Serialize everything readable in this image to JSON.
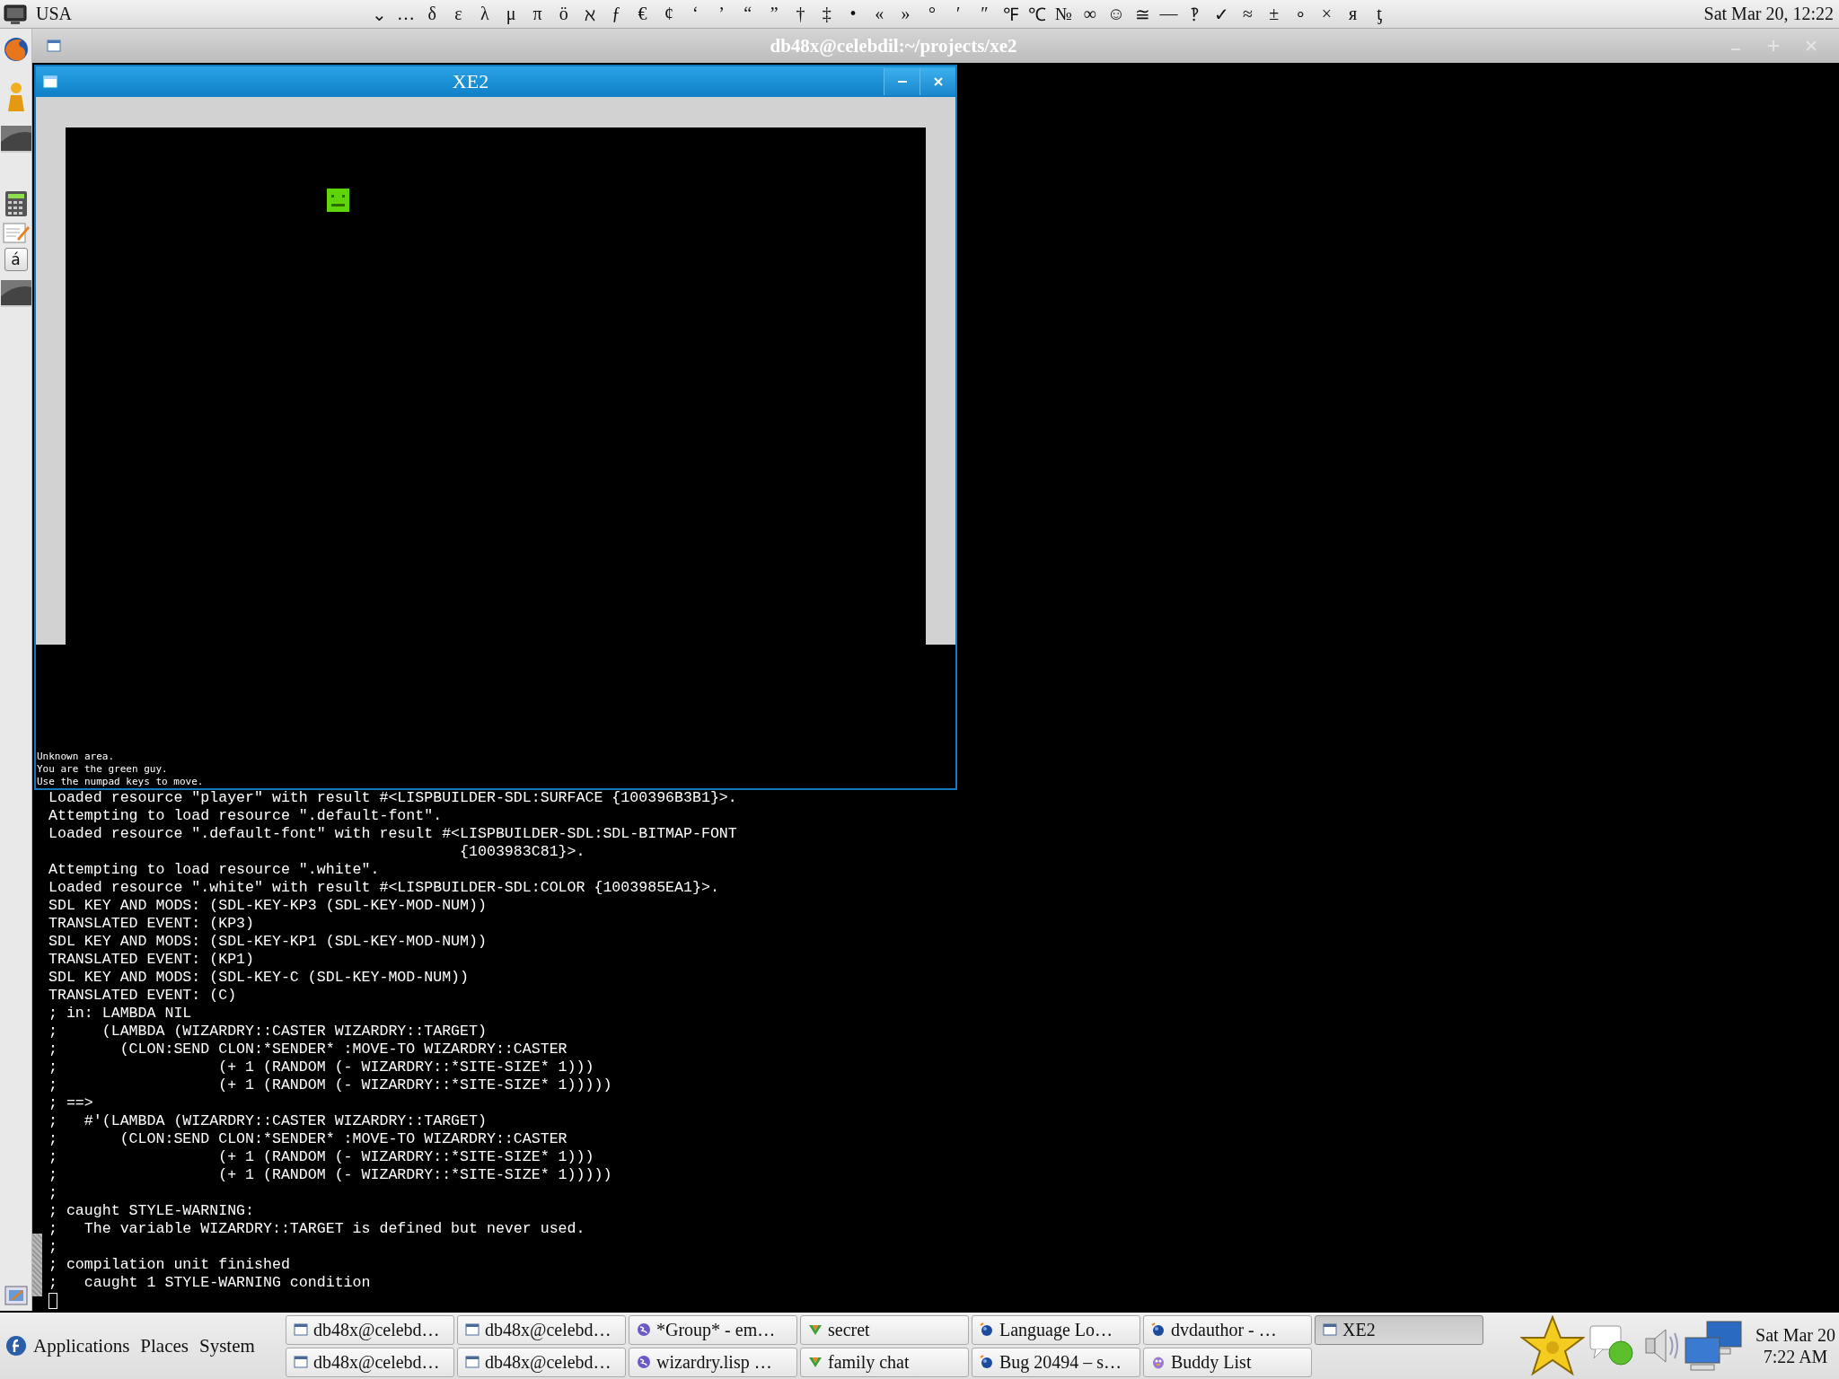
{
  "top_panel": {
    "keyboard_layout": "USA",
    "characters": [
      "⌄",
      "…",
      "δ",
      "ε",
      "λ",
      "μ",
      "π",
      "ö",
      "ℵ",
      "ƒ",
      "€",
      "¢",
      "‘",
      "’",
      "“",
      "”",
      "†",
      "‡",
      "•",
      "«",
      "»",
      "°",
      "′",
      "″",
      "℉",
      "℃",
      "№",
      "∞",
      "☺",
      "≅",
      "—",
      "‽",
      "✓",
      "≈",
      "±",
      "∘",
      "×",
      "я",
      "ƫ"
    ],
    "clock": "Sat Mar 20, 12:22"
  },
  "dock": {
    "key_label": "á"
  },
  "terminal": {
    "title": "db48x@celebdil:~/projects/xe2",
    "lines": [
      "Loaded resource \"player\" with result #<LISPBUILDER-SDL:SURFACE {100396B3B1}>.",
      "Attempting to load resource \".default-font\".",
      "Loaded resource \".default-font\" with result #<LISPBUILDER-SDL:SDL-BITMAP-FONT",
      "                                              {1003983C81}>.",
      "Attempting to load resource \".white\".",
      "Loaded resource \".white\" with result #<LISPBUILDER-SDL:COLOR {1003985EA1}>.",
      "SDL KEY AND MODS: (SDL-KEY-KP3 (SDL-KEY-MOD-NUM))",
      "TRANSLATED EVENT: (KP3)",
      "SDL KEY AND MODS: (SDL-KEY-KP1 (SDL-KEY-MOD-NUM))",
      "TRANSLATED EVENT: (KP1)",
      "SDL KEY AND MODS: (SDL-KEY-C (SDL-KEY-MOD-NUM))",
      "TRANSLATED EVENT: (C)",
      "; in: LAMBDA NIL",
      ";     (LAMBDA (WIZARDRY::CASTER WIZARDRY::TARGET)",
      ";       (CLON:SEND CLON:*SENDER* :MOVE-TO WIZARDRY::CASTER",
      ";                  (+ 1 (RANDOM (- WIZARDRY::*SITE-SIZE* 1)))",
      ";                  (+ 1 (RANDOM (- WIZARDRY::*SITE-SIZE* 1)))))",
      "; ==>",
      ";   #'(LAMBDA (WIZARDRY::CASTER WIZARDRY::TARGET)",
      ";       (CLON:SEND CLON:*SENDER* :MOVE-TO WIZARDRY::CASTER",
      ";                  (+ 1 (RANDOM (- WIZARDRY::*SITE-SIZE* 1)))",
      ";                  (+ 1 (RANDOM (- WIZARDRY::*SITE-SIZE* 1)))))",
      ";",
      "; caught STYLE-WARNING:",
      ";   The variable WIZARDRY::TARGET is defined but never used.",
      ";",
      "; compilation unit finished",
      ";   caught 1 STYLE-WARNING condition"
    ]
  },
  "game_window": {
    "title": "XE2",
    "messages": [
      "Unknown area.",
      "You are the green guy.",
      "Use the numpad keys to move."
    ]
  },
  "bottom_panel": {
    "menus": [
      "Applications",
      "Places",
      "System"
    ],
    "tasks": [
      {
        "label": "db48x@celebd…",
        "kind": "window",
        "selected": false
      },
      {
        "label": "db48x@celebd…",
        "kind": "window",
        "selected": false
      },
      {
        "label": "db48x@celebd…",
        "kind": "window",
        "selected": false
      },
      {
        "label": "db48x@celebd…",
        "kind": "window",
        "selected": false
      },
      {
        "label": "*Group* - em…",
        "kind": "emacs",
        "selected": false
      },
      {
        "label": "wizardry.lisp …",
        "kind": "emacs",
        "selected": false
      },
      {
        "label": "secret",
        "kind": "chat",
        "selected": false
      },
      {
        "label": "family chat",
        "kind": "chat",
        "selected": false
      },
      {
        "label": "Language Lo…",
        "kind": "browser",
        "selected": false
      },
      {
        "label": "Bug 20494 – s…",
        "kind": "browser",
        "selected": false
      },
      {
        "label": "dvdauthor - …",
        "kind": "browser",
        "selected": false
      },
      {
        "label": "Buddy List",
        "kind": "buddy",
        "selected": false
      },
      {
        "label": "XE2",
        "kind": "window",
        "selected": true
      }
    ],
    "clock_date": "Sat Mar 20",
    "clock_time": "7:22 AM"
  }
}
